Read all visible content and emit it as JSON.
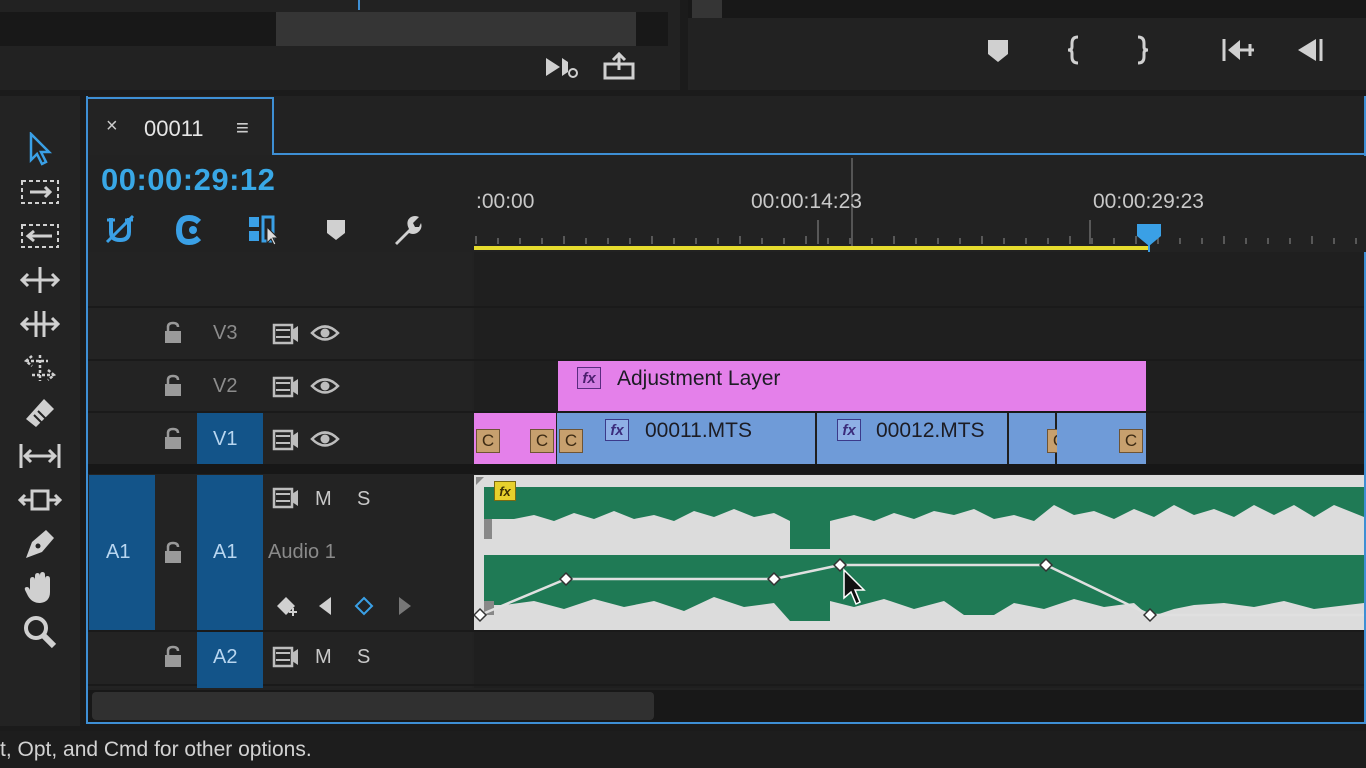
{
  "sequence": {
    "tab_title": "00011",
    "tab_close": "×",
    "tab_menu": "≡",
    "timecode": "00:00:29:12"
  },
  "ruler": {
    "labels": [
      ":00:00",
      "00:00:14:23",
      "00:00:29:23"
    ]
  },
  "tracks": {
    "v3": {
      "label": "V3"
    },
    "v2": {
      "label": "V2"
    },
    "v1": {
      "label": "V1"
    },
    "a1": {
      "source": "A1",
      "label": "A1",
      "name": "Audio 1",
      "mute": "M",
      "solo": "S"
    },
    "a2": {
      "label": "A2",
      "mute": "M",
      "solo": "S"
    }
  },
  "clips": {
    "adjustment": {
      "name": "Adjustment Layer",
      "fx": "fx"
    },
    "clip1": {
      "name": "00011.MTS",
      "fx": "fx"
    },
    "clip2": {
      "name": "00012.MTS",
      "fx": "fx"
    },
    "audio_fx": "fx",
    "badge": "C"
  },
  "status_text": "t, Opt, and Cmd for other options.",
  "colors": {
    "accent": "#3e8fd4",
    "timecode": "#39a8e6",
    "adjustment_clip": "#e480ea",
    "video_clip": "#6f9bd8",
    "audio_wave": "#1f7a55",
    "work_area": "#e6dc2e"
  }
}
